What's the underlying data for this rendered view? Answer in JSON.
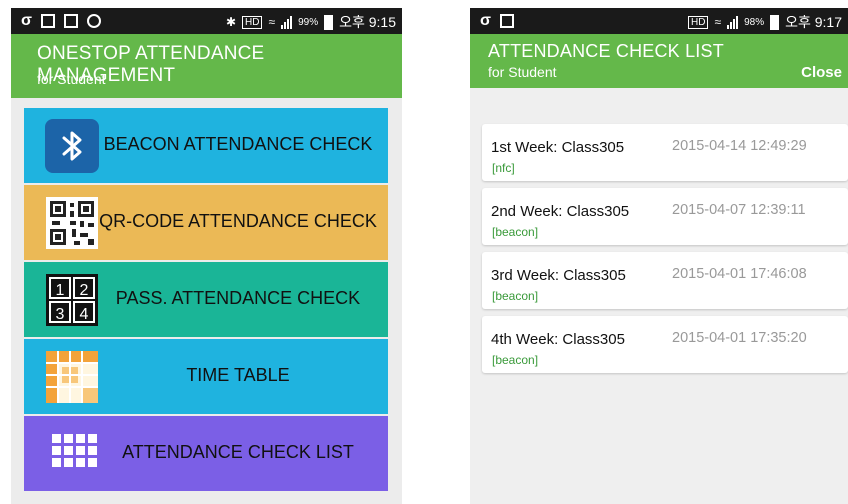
{
  "left_screen": {
    "status": {
      "carrier_icon": "σ",
      "bluetooth": "✱",
      "hd": "HD",
      "battery": "99%",
      "time": "오후 9:15"
    },
    "header": {
      "title": "ONESTOP ATTENDANCE MANAGEMENT",
      "subtitle": "for Student"
    },
    "menu": [
      {
        "label": "BEACON ATTENDANCE CHECK",
        "icon": "bluetooth-icon",
        "color": "#1fb3df"
      },
      {
        "label": "QR-CODE ATTENDANCE CHECK",
        "icon": "qr-code-icon",
        "color": "#ebb956"
      },
      {
        "label": "PASS. ATTENDANCE CHECK",
        "icon": "keypad-icon",
        "icon_text": [
          "1",
          "2",
          "3",
          "4"
        ],
        "color": "#1ab597"
      },
      {
        "label": "TIME TABLE",
        "icon": "timetable-icon",
        "color": "#1fb3df"
      },
      {
        "label": "ATTENDANCE CHECK LIST",
        "icon": "grid-icon",
        "color": "#7b5fe6"
      }
    ]
  },
  "right_screen": {
    "status": {
      "carrier_icon": "σ",
      "hd": "HD",
      "battery": "98%",
      "time": "오후 9:17"
    },
    "header": {
      "title": "ATTENDANCE CHECK LIST",
      "subtitle": "for Student",
      "close": "Close"
    },
    "records": [
      {
        "title": "1st Week: Class305",
        "date": "2015-04-14 12:49:29",
        "tag": "[nfc]"
      },
      {
        "title": "2nd Week: Class305",
        "date": "2015-04-07 12:39:11",
        "tag": "[beacon]"
      },
      {
        "title": "3rd Week: Class305",
        "date": "2015-04-01 17:46:08",
        "tag": "[beacon]"
      },
      {
        "title": "4th Week: Class305",
        "date": "2015-04-01 17:35:20",
        "tag": "[beacon]"
      }
    ]
  },
  "colors": {
    "appbar": "#64b84a",
    "statusbar": "#1a1a1a",
    "beacon": "#1fb3df",
    "qr": "#ebb956",
    "pass": "#1ab597",
    "timetable": "#1fb3df",
    "list": "#7b5fe6",
    "tag": "#3a9a3a"
  }
}
